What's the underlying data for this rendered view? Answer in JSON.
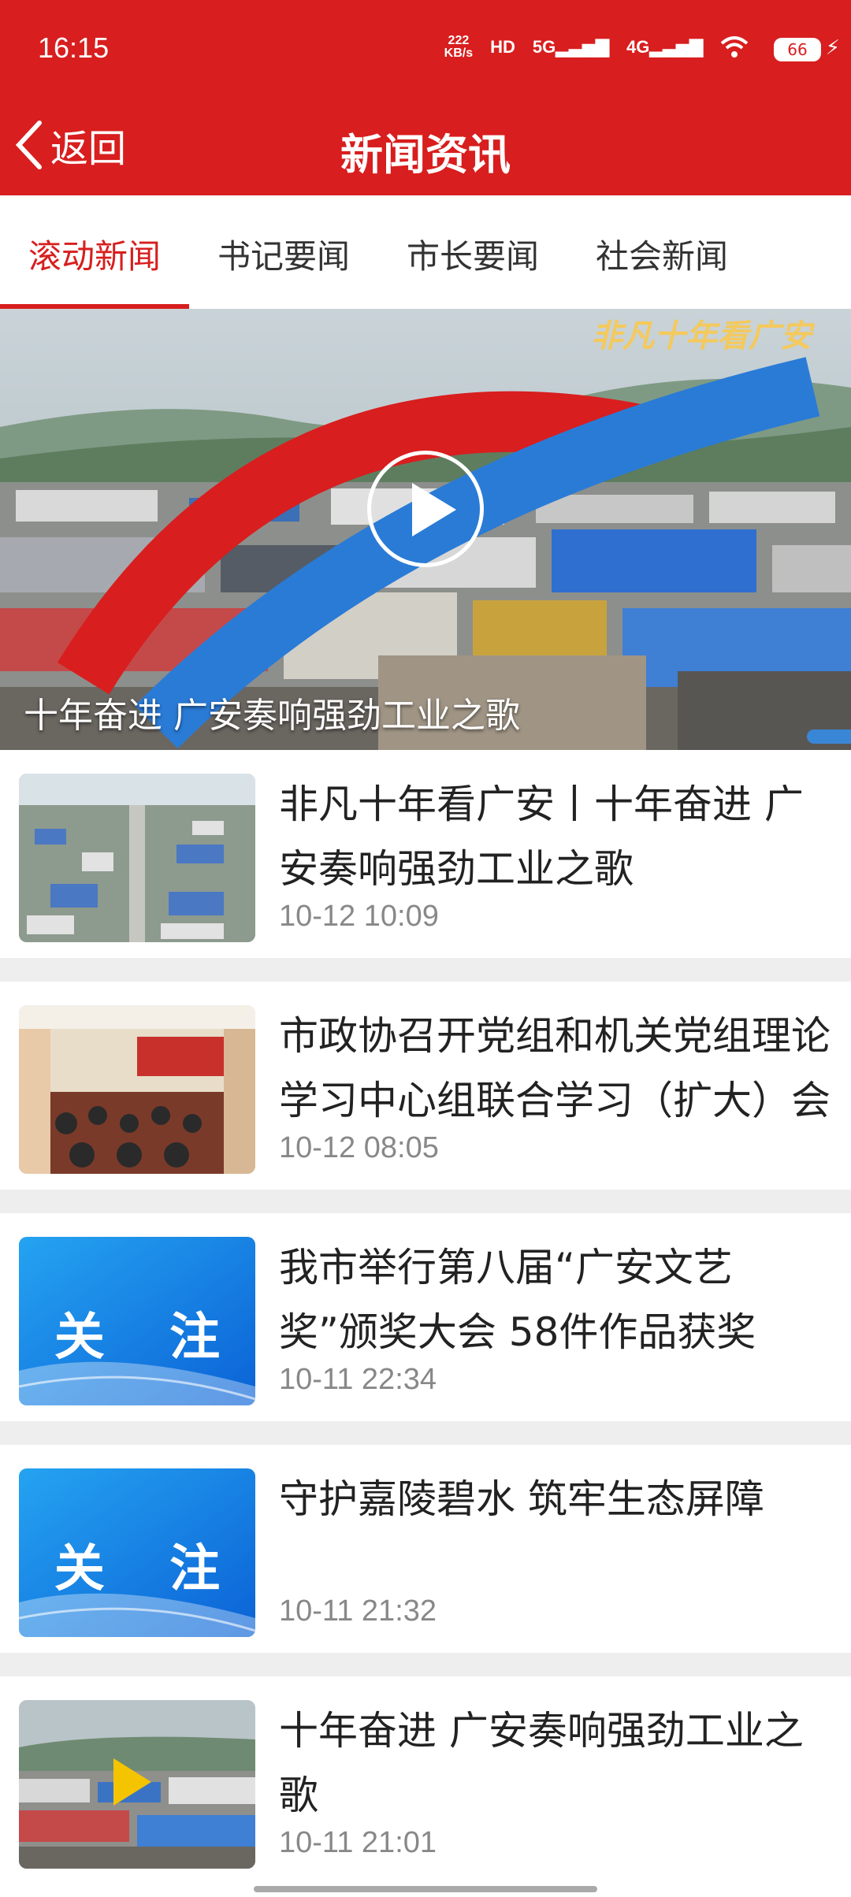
{
  "status_bar": {
    "time": "16:15",
    "net_speed_value": "222",
    "net_speed_unit": "KB/s",
    "hd": "HD",
    "sim1": "5G",
    "sim2": "4G",
    "battery": "66",
    "icons": [
      "network-speed",
      "hd-icon",
      "5g-signal-icon",
      "4g-signal-icon",
      "wifi-icon",
      "battery-icon",
      "charging-icon"
    ]
  },
  "nav": {
    "back_label": "返回",
    "title": "新闻资讯"
  },
  "tabs": [
    {
      "label": "滚动新闻",
      "active": true
    },
    {
      "label": "书记要闻",
      "active": false
    },
    {
      "label": "市长要闻",
      "active": false
    },
    {
      "label": "社会新闻",
      "active": false
    }
  ],
  "hero": {
    "caption": "十年奋进 广安奏响强劲工业之歌",
    "badge": "非凡十年看广安"
  },
  "news": [
    {
      "title": "非凡十年看广安丨十年奋进 广安奏响强劲工业之歌",
      "time": "10-12 10:09",
      "thumb": "aerial-industrial-park"
    },
    {
      "title": "市政协召开党组和机关党组理论学习中心组联合学习（扩大）会议",
      "time": "10-12 08:05",
      "thumb": "meeting-room"
    },
    {
      "title": "我市举行第八届“广安文艺奖”颁奖大会 58件作品获奖",
      "time": "10-11 22:34",
      "thumb": "focus-card",
      "thumb_text": "关 注"
    },
    {
      "title": "守护嘉陵碧水 筑牢生态屏障",
      "time": "10-11 21:32",
      "thumb": "focus-card",
      "thumb_text": "关 注"
    },
    {
      "title": "十年奋进 广安奏响强劲工业之歌",
      "time": "10-11 21:01",
      "thumb": "video-factory"
    }
  ],
  "colors": {
    "brand_red": "#d81e1e",
    "tab_active": "#d81e1e",
    "time_gray": "#888888",
    "focus_blue": "#1e88e5"
  }
}
